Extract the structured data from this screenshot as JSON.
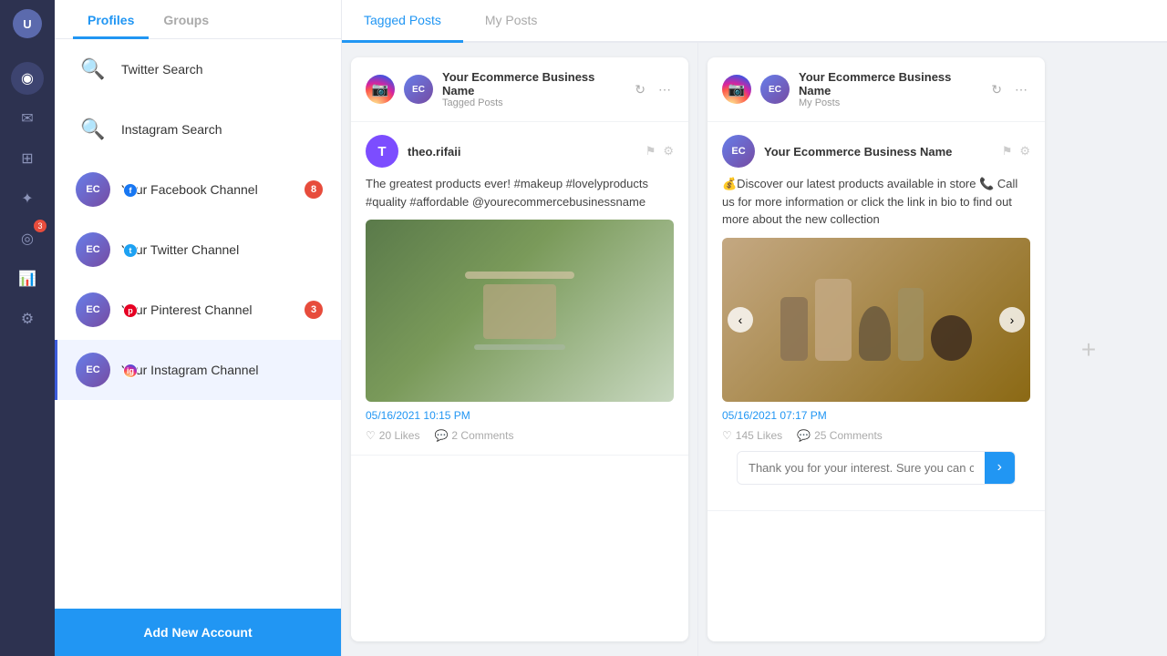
{
  "nav": {
    "avatar_label": "U",
    "icons": [
      {
        "name": "dashboard-icon",
        "symbol": "◉"
      },
      {
        "name": "inbox-icon",
        "symbol": "✉"
      },
      {
        "name": "publish-icon",
        "symbol": "⊞"
      },
      {
        "name": "engage-icon",
        "symbol": "✦"
      },
      {
        "name": "listen-icon",
        "symbol": "◎"
      },
      {
        "name": "reports-icon",
        "symbol": "📊"
      },
      {
        "name": "settings-icon",
        "symbol": "⚙"
      }
    ]
  },
  "sidebar": {
    "tabs": [
      {
        "label": "Profiles",
        "active": true
      },
      {
        "label": "Groups",
        "active": false
      }
    ],
    "items": [
      {
        "id": "twitter-search",
        "label": "Twitter Search",
        "icon": "🔍",
        "icon_color": "#1da1f2",
        "badge": null,
        "social": null
      },
      {
        "id": "instagram-search",
        "label": "Instagram Search",
        "icon": "🔍",
        "icon_color": "#e1306c",
        "badge": null,
        "social": null
      },
      {
        "id": "facebook-channel",
        "label": "Your Facebook Channel",
        "icon": "📷",
        "icon_color": "#1877f2",
        "badge": "8",
        "social": "fb"
      },
      {
        "id": "twitter-channel",
        "label": "Your Twitter Channel",
        "icon": "📷",
        "icon_color": "#1da1f2",
        "badge": null,
        "social": "tw"
      },
      {
        "id": "pinterest-channel",
        "label": "Your Pinterest Channel",
        "icon": "📷",
        "icon_color": "#e60023",
        "badge": "3",
        "social": "pt"
      },
      {
        "id": "instagram-channel",
        "label": "Your Instagram Channel",
        "icon": "📷",
        "icon_color": "#e1306c",
        "badge": null,
        "social": "ig",
        "active": true
      }
    ],
    "add_button": "Add New Account"
  },
  "main": {
    "tabs": [
      {
        "label": "Tagged Posts",
        "active": false
      },
      {
        "label": "My Posts",
        "active": false
      }
    ],
    "columns": [
      {
        "id": "col1",
        "account": "Your Ecommerce Business Name",
        "subtitle": "Tagged Posts",
        "icon_type": "ig",
        "posts": [
          {
            "id": "post1",
            "author": "theo.rifaii",
            "avatar_letter": "T",
            "avatar_color": "purple",
            "text": "The greatest products ever! #makeup #lovelyproducts #quality #affordable @yourecommercebusinessname",
            "has_image": true,
            "image_type": "green",
            "timestamp": "05/16/2021 10:15 PM",
            "likes": "20 Likes",
            "comments": "2 Comments"
          }
        ]
      },
      {
        "id": "col2",
        "account": "Your Ecommerce Business Name",
        "subtitle": "My Posts",
        "icon_type": "ig",
        "posts": [
          {
            "id": "post2",
            "author": "Your Ecommerce Business Name",
            "avatar_type": "biz",
            "text": "💰Discover our latest products available in store 📞 Call us for more information or click the link in bio to find out more about the new collection",
            "has_image": true,
            "image_type": "products",
            "timestamp": "05/16/2021 07:17 PM",
            "likes": "145 Likes",
            "comments": "25 Comments",
            "reply_placeholder": "Thank you for your interest. Sure you can chec..."
          }
        ]
      }
    ],
    "refresh_icon": "↻",
    "more_icon": "⋯",
    "add_column_icon": "+"
  }
}
